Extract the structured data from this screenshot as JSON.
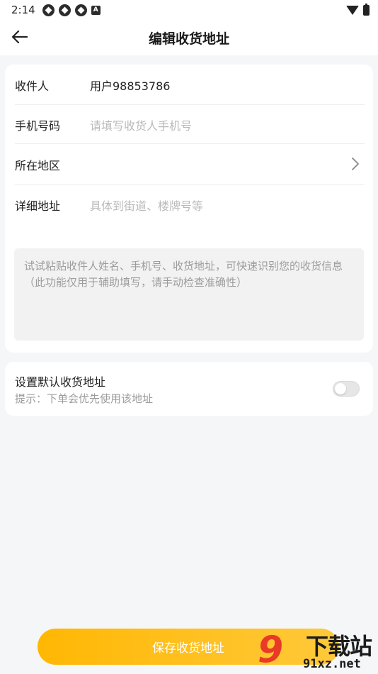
{
  "status_bar": {
    "time": "2:14",
    "notif_glyph": "A"
  },
  "header": {
    "title": "编辑收货地址"
  },
  "form": {
    "recipient_label": "收件人",
    "recipient_value": "用户98853786",
    "phone_label": "手机号码",
    "phone_placeholder": "请填写收货人手机号",
    "region_label": "所在地区",
    "address_label": "详细地址",
    "address_placeholder": "具体到街道、楼牌号等",
    "paste_hint_line1": "试试粘贴收件人姓名、手机号、收货地址，可快速识别您的收货信息",
    "paste_hint_line2": "（此功能仅用于辅助填写，请手动检查准确性）"
  },
  "default_setting": {
    "title": "设置默认收货地址",
    "hint": "提示：下单会优先使用该地址",
    "enabled": false
  },
  "save_button": {
    "label": "保存收货地址"
  },
  "watermark": {
    "logo": "9",
    "text": "下载站",
    "url": "91xz.net"
  },
  "colors": {
    "accent": "#ffb703",
    "background": "#f5f6f8",
    "placeholder": "#b9b9b9"
  }
}
